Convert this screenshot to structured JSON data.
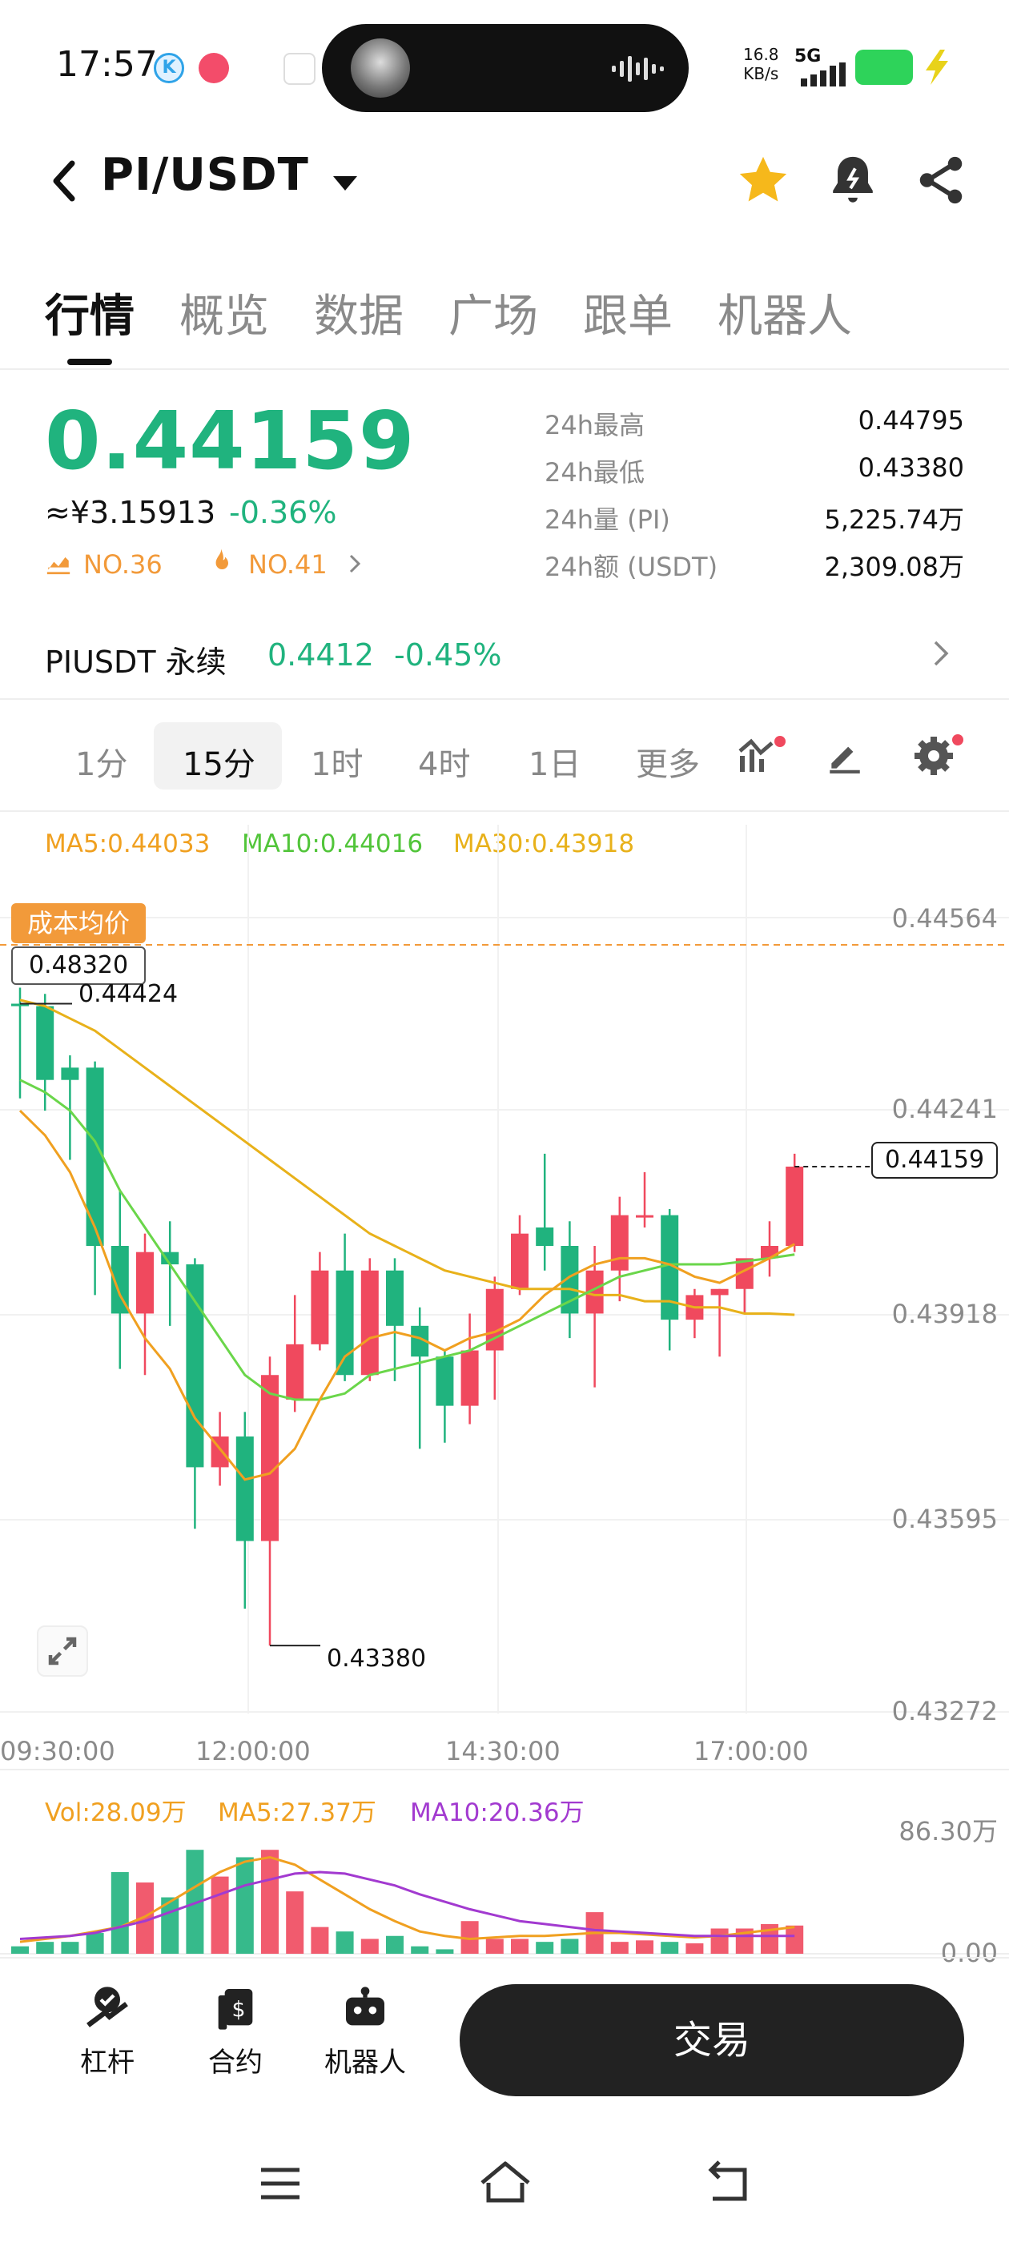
{
  "status": {
    "time": "17:57",
    "net_speed_value": "16.8",
    "net_speed_unit": "KB/s",
    "signal": "5G"
  },
  "header": {
    "pair": "PI/USDT"
  },
  "tabs": [
    "行情",
    "概览",
    "数据",
    "广场",
    "跟单",
    "机器人"
  ],
  "price": {
    "last": "0.44159",
    "cny": "≈¥3.15913",
    "change": "-0.36%",
    "rank1": "NO.36",
    "rank2": "NO.41"
  },
  "stats": [
    {
      "label": "24h最高",
      "value": "0.44795"
    },
    {
      "label": "24h最低",
      "value": "0.43380"
    },
    {
      "label": "24h量 (PI)",
      "value": "5,225.74万"
    },
    {
      "label": "24h额 (USDT)",
      "value": "2,309.08万"
    }
  ],
  "perp": {
    "name": "PIUSDT 永续",
    "price": "0.4412",
    "change": "-0.45%"
  },
  "timeframes": [
    "1分",
    "15分",
    "1时",
    "4时",
    "1日",
    "更多"
  ],
  "active_timeframe": "15分",
  "ma_legend": {
    "ma5": "MA5:0.44033",
    "ma10": "MA10:0.44016",
    "ma30": "MA30:0.43918"
  },
  "cost_label": "成本均价",
  "cost_value": "0.48320",
  "price_axis": [
    "0.44564",
    "0.44241",
    "0.43918",
    "0.43595",
    "0.43272"
  ],
  "time_axis": [
    "09:30:00",
    "12:00:00",
    "14:30:00",
    "17:00:00"
  ],
  "high_marker": "0.44424",
  "low_marker": "0.43380",
  "last_marker": "0.44159",
  "vol_legend": {
    "vol": "Vol:28.09万",
    "ma5": "MA5:27.37万",
    "ma10": "MA10:20.36万"
  },
  "vol_axis": [
    "86.30万",
    "0.00"
  ],
  "bottom_nav": [
    {
      "label": "杠杆"
    },
    {
      "label": "合约"
    },
    {
      "label": "机器人"
    }
  ],
  "trade_button": "交易",
  "colors": {
    "up": "#20b37e",
    "down": "#f0495e",
    "ma5": "#f0a020",
    "ma10": "#6ad64a",
    "ma30": "#e8b11a",
    "vol_ma10": "#a23ad0",
    "cost": "#f29a3a"
  },
  "chart_data": {
    "type": "candlestick",
    "y_range": [
      0.43272,
      0.44564
    ],
    "candles": [
      {
        "o": 0.44424,
        "h": 0.4445,
        "l": 0.4427,
        "c": 0.4442
      },
      {
        "o": 0.4442,
        "h": 0.4444,
        "l": 0.4425,
        "c": 0.443
      },
      {
        "o": 0.4432,
        "h": 0.4434,
        "l": 0.4417,
        "c": 0.443
      },
      {
        "o": 0.4432,
        "h": 0.4433,
        "l": 0.4395,
        "c": 0.4403
      },
      {
        "o": 0.4403,
        "h": 0.4412,
        "l": 0.4383,
        "c": 0.4392
      },
      {
        "o": 0.4392,
        "h": 0.4405,
        "l": 0.4382,
        "c": 0.4402
      },
      {
        "o": 0.4402,
        "h": 0.4407,
        "l": 0.439,
        "c": 0.44
      },
      {
        "o": 0.44,
        "h": 0.4401,
        "l": 0.4357,
        "c": 0.4367
      },
      {
        "o": 0.4367,
        "h": 0.4376,
        "l": 0.4364,
        "c": 0.4372
      },
      {
        "o": 0.4372,
        "h": 0.4376,
        "l": 0.4344,
        "c": 0.4355
      },
      {
        "o": 0.4355,
        "h": 0.4385,
        "l": 0.4338,
        "c": 0.4382
      },
      {
        "o": 0.4378,
        "h": 0.4395,
        "l": 0.4376,
        "c": 0.4387
      },
      {
        "o": 0.4387,
        "h": 0.4402,
        "l": 0.4386,
        "c": 0.4399
      },
      {
        "o": 0.4399,
        "h": 0.4405,
        "l": 0.4381,
        "c": 0.4382
      },
      {
        "o": 0.4382,
        "h": 0.4401,
        "l": 0.4381,
        "c": 0.4399
      },
      {
        "o": 0.4399,
        "h": 0.4401,
        "l": 0.4381,
        "c": 0.439
      },
      {
        "o": 0.439,
        "h": 0.4393,
        "l": 0.437,
        "c": 0.4385
      },
      {
        "o": 0.4385,
        "h": 0.4386,
        "l": 0.4371,
        "c": 0.4377
      },
      {
        "o": 0.4377,
        "h": 0.4392,
        "l": 0.4374,
        "c": 0.4386
      },
      {
        "o": 0.4386,
        "h": 0.4398,
        "l": 0.4378,
        "c": 0.4396
      },
      {
        "o": 0.4396,
        "h": 0.4408,
        "l": 0.4395,
        "c": 0.4405
      },
      {
        "o": 0.4406,
        "h": 0.4418,
        "l": 0.4399,
        "c": 0.4403
      },
      {
        "o": 0.4403,
        "h": 0.4407,
        "l": 0.4388,
        "c": 0.4392
      },
      {
        "o": 0.4392,
        "h": 0.4403,
        "l": 0.438,
        "c": 0.4399
      },
      {
        "o": 0.4399,
        "h": 0.4411,
        "l": 0.4394,
        "c": 0.4408
      },
      {
        "o": 0.4408,
        "h": 0.4415,
        "l": 0.4406,
        "c": 0.4408
      },
      {
        "o": 0.4408,
        "h": 0.4409,
        "l": 0.4386,
        "c": 0.4391
      },
      {
        "o": 0.4391,
        "h": 0.4396,
        "l": 0.4388,
        "c": 0.4395
      },
      {
        "o": 0.4395,
        "h": 0.4396,
        "l": 0.4385,
        "c": 0.4396
      },
      {
        "o": 0.4396,
        "h": 0.44,
        "l": 0.4392,
        "c": 0.4401
      },
      {
        "o": 0.4401,
        "h": 0.4407,
        "l": 0.4398,
        "c": 0.4403
      },
      {
        "o": 0.4403,
        "h": 0.4418,
        "l": 0.4402,
        "c": 0.44159
      }
    ],
    "ma5": [
      0.4425,
      0.4421,
      0.4415,
      0.4406,
      0.4395,
      0.4388,
      0.4383,
      0.4375,
      0.437,
      0.4365,
      0.4366,
      0.437,
      0.4378,
      0.4385,
      0.4388,
      0.4389,
      0.4388,
      0.4386,
      0.4388,
      0.4389,
      0.4391,
      0.4395,
      0.4398,
      0.44,
      0.4401,
      0.4401,
      0.44,
      0.4398,
      0.4397,
      0.4399,
      0.4401,
      0.44033
    ],
    "ma10": [
      0.443,
      0.4428,
      0.4425,
      0.442,
      0.4412,
      0.4406,
      0.44,
      0.4394,
      0.4388,
      0.4382,
      0.4379,
      0.4378,
      0.4378,
      0.4379,
      0.4382,
      0.4383,
      0.4384,
      0.4385,
      0.4386,
      0.4388,
      0.439,
      0.4392,
      0.4394,
      0.4396,
      0.4398,
      0.4399,
      0.44,
      0.44,
      0.44,
      0.44005,
      0.4401,
      0.44016
    ],
    "ma30": [
      0.4443,
      0.4442,
      0.444,
      0.4438,
      0.4435,
      0.4432,
      0.4429,
      0.4426,
      0.4423,
      0.442,
      0.4417,
      0.4414,
      0.4411,
      0.4408,
      0.4405,
      0.4403,
      0.4401,
      0.4399,
      0.4398,
      0.4397,
      0.4396,
      0.4396,
      0.4396,
      0.4395,
      0.4395,
      0.4394,
      0.4394,
      0.4393,
      0.4393,
      0.4392,
      0.4392,
      0.43918
    ],
    "volume": [
      5,
      8,
      8,
      14,
      55,
      48,
      38,
      70,
      52,
      65,
      70,
      42,
      18,
      15,
      10,
      12,
      5,
      3,
      22,
      10,
      10,
      8,
      10,
      28,
      8,
      9,
      8,
      7,
      17,
      17,
      20,
      19
    ],
    "vol_ma5": [
      8,
      10,
      12,
      15,
      18,
      25,
      35,
      45,
      55,
      62,
      65,
      60,
      50,
      40,
      30,
      22,
      15,
      12,
      10,
      11,
      12,
      12,
      13,
      14,
      14,
      13,
      12,
      11,
      12,
      14,
      16,
      18
    ],
    "vol_ma10": [
      10,
      11,
      12,
      14,
      18,
      22,
      28,
      34,
      40,
      46,
      50,
      54,
      55,
      54,
      50,
      46,
      40,
      35,
      30,
      26,
      22,
      20,
      18,
      16,
      15,
      14,
      13,
      12,
      12,
      12,
      12,
      12
    ],
    "vol_range": [
      0,
      86.3
    ]
  }
}
